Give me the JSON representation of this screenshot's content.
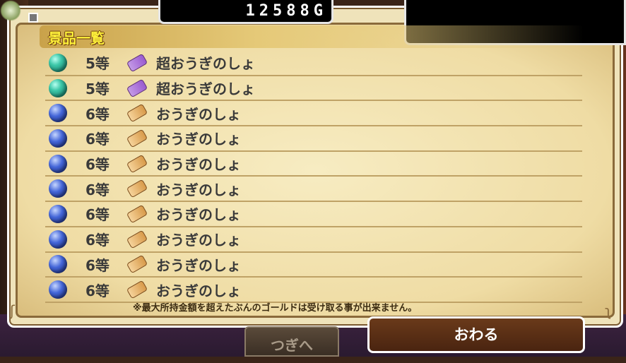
{
  "gold": "12588G",
  "title": "景品一覧",
  "note": "※最大所持金額を超えたぶんのゴールドは受け取る事が出来ません。",
  "prizes": [
    {
      "orb": "teal-orb-icon",
      "rank": "5等",
      "scroll": "purple-scroll-icon",
      "name": "超おうぎのしょ"
    },
    {
      "orb": "teal-orb-icon",
      "rank": "5等",
      "scroll": "purple-scroll-icon",
      "name": "超おうぎのしょ"
    },
    {
      "orb": "blue-orb-icon",
      "rank": "6等",
      "scroll": "orange-scroll-icon",
      "name": "おうぎのしょ"
    },
    {
      "orb": "blue-orb-icon",
      "rank": "6等",
      "scroll": "orange-scroll-icon",
      "name": "おうぎのしょ"
    },
    {
      "orb": "blue-orb-icon",
      "rank": "6等",
      "scroll": "orange-scroll-icon",
      "name": "おうぎのしょ"
    },
    {
      "orb": "blue-orb-icon",
      "rank": "6等",
      "scroll": "orange-scroll-icon",
      "name": "おうぎのしょ"
    },
    {
      "orb": "blue-orb-icon",
      "rank": "6等",
      "scroll": "orange-scroll-icon",
      "name": "おうぎのしょ"
    },
    {
      "orb": "blue-orb-icon",
      "rank": "6等",
      "scroll": "orange-scroll-icon",
      "name": "おうぎのしょ"
    },
    {
      "orb": "blue-orb-icon",
      "rank": "6等",
      "scroll": "orange-scroll-icon",
      "name": "おうぎのしょ"
    },
    {
      "orb": "blue-orb-icon",
      "rank": "6等",
      "scroll": "orange-scroll-icon",
      "name": "おうぎのしょ"
    }
  ],
  "buttons": {
    "next": "つぎへ",
    "end": "おわる"
  },
  "colors": {
    "title": "#fff23a",
    "parchment": "#efdca4",
    "end_button": "#5a2c14"
  }
}
